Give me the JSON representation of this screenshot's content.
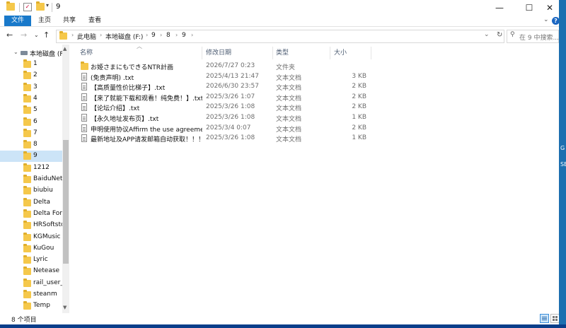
{
  "window": {
    "title": "9",
    "controls": {
      "minimize": "—",
      "maximize": "☐",
      "close": "✕"
    }
  },
  "ribbon": {
    "file_tab": "文件",
    "tabs": [
      "主页",
      "共享",
      "查看"
    ],
    "expand_glyph": "⌄",
    "help_glyph": "?"
  },
  "address": {
    "crumbs": [
      "此电脑",
      "本地磁盘 (F:)",
      "9",
      "8",
      "9"
    ],
    "separator": "›"
  },
  "search": {
    "placeholder": "在 9 中搜索..."
  },
  "nav_pane": {
    "drive_label": "本地磁盘 (F:",
    "items": [
      "1",
      "2",
      "3",
      "4",
      "5",
      "6",
      "7",
      "8",
      "9",
      "1212",
      "BaiduNetdisk",
      "biubiu",
      "Delta",
      "Delta Force",
      "HRSoftstore",
      "KGMusic",
      "KuGou",
      "Lyric",
      "Netease",
      "rail_user_data",
      "steanm",
      "Temp"
    ],
    "selected": "9"
  },
  "columns": {
    "name": "名称",
    "modified": "修改日期",
    "type": "类型",
    "size": "大小"
  },
  "files": [
    {
      "icon": "folder-icon",
      "name": "お姫さまにもできるNTR計画",
      "modified": "2026/7/27 0:23",
      "type": "文件夹",
      "size": ""
    },
    {
      "icon": "text-file-icon",
      "name": "(免责声明) .txt",
      "modified": "2025/4/13 21:47",
      "type": "文本文档",
      "size": "3 KB"
    },
    {
      "icon": "text-file-icon",
      "name": "【高质量性价比梯子】.txt",
      "modified": "2026/6/30 23:57",
      "type": "文本文档",
      "size": "2 KB"
    },
    {
      "icon": "text-file-icon",
      "name": "【来了就能下载和观看！纯免费！】.txt",
      "modified": "2025/3/26 1:07",
      "type": "文本文档",
      "size": "2 KB"
    },
    {
      "icon": "text-file-icon",
      "name": "【论坛介绍】.txt",
      "modified": "2025/3/26 1:08",
      "type": "文本文档",
      "size": "2 KB"
    },
    {
      "icon": "text-file-icon",
      "name": "【永久地址发布页】.txt",
      "modified": "2025/3/26 1:08",
      "type": "文本文档",
      "size": "1 KB"
    },
    {
      "icon": "text-file-icon",
      "name": "申明使用协议Affirm the use agreement.txt",
      "modified": "2025/3/4 0:07",
      "type": "文本文档",
      "size": "2 KB"
    },
    {
      "icon": "text-file-icon",
      "name": "最新地址及APP请发邮箱自动获取！！！.txt",
      "modified": "2025/3/26 1:08",
      "type": "文本文档",
      "size": "1 KB"
    }
  ],
  "status": {
    "item_count": "8 个项目"
  },
  "desktop_edge": [
    "G",
    "SE"
  ],
  "colors": {
    "accent": "#1979ca",
    "selection": "#cce4f7",
    "folder": "#f5c84b",
    "desktop": "#1c6fb0"
  }
}
